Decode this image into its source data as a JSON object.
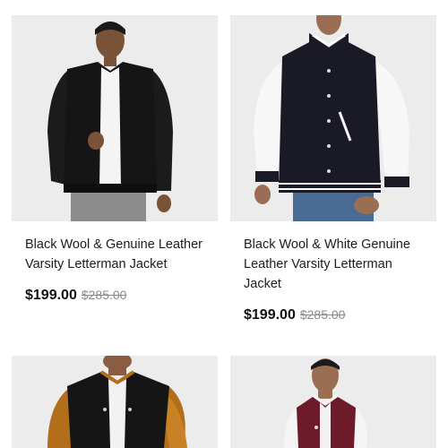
{
  "products": [
    {
      "title": "Black Wool & Genuine Leather Varsity Letterman Jacket",
      "price": "$199.00",
      "compare_price": "$285.00",
      "image": "black-wool-black-leather-jacket"
    },
    {
      "title": "Black Wool & White Genuine Leather Varsity Letterman Jacket",
      "price": "$199.00",
      "compare_price": "$285.00",
      "image": "black-wool-white-leather-jacket"
    },
    {
      "title": "",
      "price": "",
      "compare_price": "",
      "image": "black-wool-gold-leather-jacket"
    },
    {
      "title": "",
      "price": "",
      "compare_price": "",
      "image": "maroon-wool-white-leather-jacket"
    }
  ],
  "colors": {
    "photo_bg": "#ececec",
    "price": "#111111",
    "compare_price": "#8a8a8a"
  }
}
